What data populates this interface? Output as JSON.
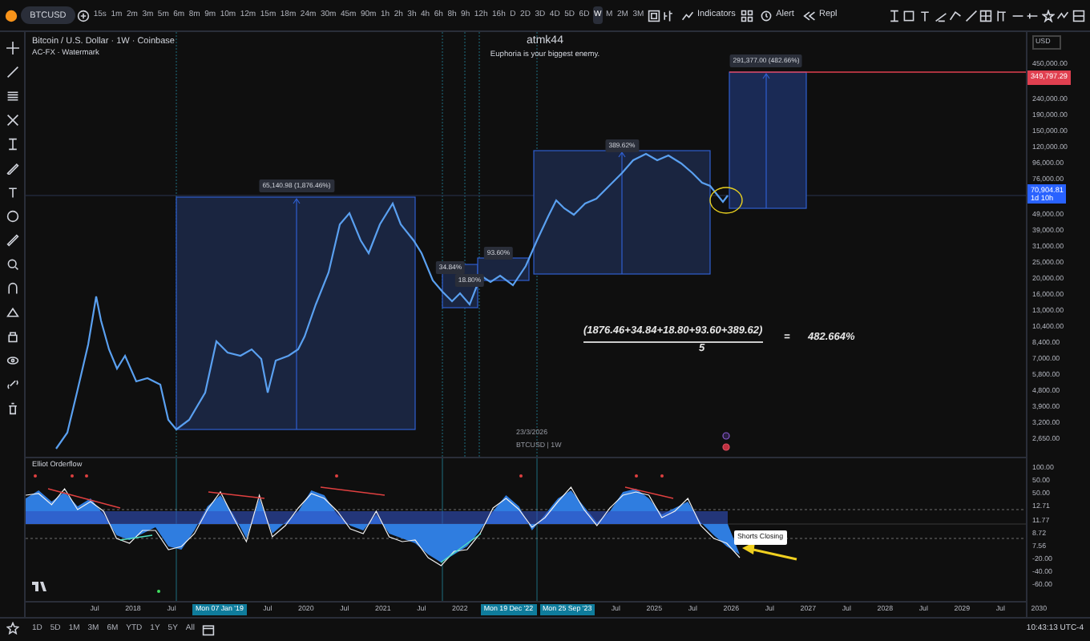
{
  "toolbar": {
    "symbol": "BTCUSD",
    "intervals": [
      {
        "label": "15s",
        "selected": false
      },
      {
        "label": "1m",
        "selected": false
      },
      {
        "label": "2m",
        "selected": false
      },
      {
        "label": "3m",
        "selected": false
      },
      {
        "label": "5m",
        "selected": false
      },
      {
        "label": "6m",
        "selected": false
      },
      {
        "label": "8m",
        "selected": false
      },
      {
        "label": "9m",
        "selected": false
      },
      {
        "label": "10m",
        "selected": false
      },
      {
        "label": "12m",
        "selected": false
      },
      {
        "label": "15m",
        "selected": false
      },
      {
        "label": "18m",
        "selected": false
      },
      {
        "label": "24m",
        "selected": false
      },
      {
        "label": "30m",
        "selected": false
      },
      {
        "label": "45m",
        "selected": false
      },
      {
        "label": "90m",
        "selected": false
      },
      {
        "label": "1h",
        "selected": false
      },
      {
        "label": "2h",
        "selected": false
      },
      {
        "label": "3h",
        "selected": false
      },
      {
        "label": "4h",
        "selected": false
      },
      {
        "label": "6h",
        "selected": false
      },
      {
        "label": "8h",
        "selected": false
      },
      {
        "label": "9h",
        "selected": false
      },
      {
        "label": "12h",
        "selected": false
      },
      {
        "label": "16h",
        "selected": false
      },
      {
        "label": "D",
        "selected": false
      },
      {
        "label": "2D",
        "selected": false
      },
      {
        "label": "3D",
        "selected": false
      },
      {
        "label": "4D",
        "selected": false
      },
      {
        "label": "5D",
        "selected": false
      },
      {
        "label": "6D",
        "selected": false
      },
      {
        "label": "W",
        "selected": true
      },
      {
        "label": "M",
        "selected": false
      },
      {
        "label": "2M",
        "selected": false
      },
      {
        "label": "3M",
        "selected": false
      }
    ],
    "indicators_button": "Indicators",
    "alert_button": "Alert",
    "replay_button": "Repl"
  },
  "legend": {
    "title": "Bitcoin / U.S. Dollar · 1W · Coinbase",
    "indicator": "AC-FX · Watermark"
  },
  "note": {
    "title": "atmk44",
    "subtitle": "Euphoria is your biggest enemy."
  },
  "measurements": [
    {
      "label": "65,140.98 (1,876.46%)"
    },
    {
      "label": "34.84%"
    },
    {
      "label": "18.80%"
    },
    {
      "label": "93.60%"
    },
    {
      "label": "389.62%"
    },
    {
      "label": "291,377.00 (482.66%)"
    }
  ],
  "formula": {
    "numerator": "(1876.46+34.84+18.80+93.60+389.62)",
    "denominator": "5",
    "equals": "=",
    "result": "482.664%"
  },
  "cursor_info": [
    "23/3/2026",
    "BTCUSD | 1W"
  ],
  "price_axis": {
    "currency": "USD",
    "ticks": [
      "450,000.00",
      "240,000.00",
      "190,000.00",
      "150,000.00",
      "120,000.00",
      "96,000.00",
      "76,000.00",
      "49,000.00",
      "39,000.00",
      "31,000.00",
      "25,000.00",
      "20,000.00",
      "16,000.00",
      "13,000.00",
      "10,400.00",
      "8,400.00",
      "7,000.00",
      "5,800.00",
      "4,800.00",
      "3,900.00",
      "3,200.00",
      "2,650.00"
    ],
    "alert_tag": "349,797.29",
    "last_price": "70,904.81",
    "countdown": "1d 10h"
  },
  "oscillator": {
    "title": "Elliot Orderflow",
    "tag": "Shorts Closing",
    "ticks": [
      "100.00",
      "50.00",
      "50.00",
      "12.71",
      "11.77",
      "8.72",
      "7.56",
      "-20.00",
      "-40.00",
      "-60.00"
    ]
  },
  "time_axis": [
    {
      "label": "Jul",
      "kind": "tick"
    },
    {
      "label": "2018",
      "kind": "tick"
    },
    {
      "label": "Jul",
      "kind": "tick"
    },
    {
      "label": "Mon 07 Jan '19",
      "kind": "marker"
    },
    {
      "label": "Jul",
      "kind": "tick"
    },
    {
      "label": "2020",
      "kind": "tick"
    },
    {
      "label": "Jul",
      "kind": "tick"
    },
    {
      "label": "2021",
      "kind": "tick"
    },
    {
      "label": "Jul",
      "kind": "tick"
    },
    {
      "label": "2022",
      "kind": "tick"
    },
    {
      "label": "Mon 19 Dec '22",
      "kind": "marker"
    },
    {
      "label": "Mon 25 Sep '23",
      "kind": "marker"
    },
    {
      "label": "Jul",
      "kind": "tick"
    },
    {
      "label": "2025",
      "kind": "tick"
    },
    {
      "label": "Jul",
      "kind": "tick"
    },
    {
      "label": "2026",
      "kind": "tick"
    },
    {
      "label": "Jul",
      "kind": "tick"
    },
    {
      "label": "2027",
      "kind": "tick"
    },
    {
      "label": "Jul",
      "kind": "tick"
    },
    {
      "label": "2028",
      "kind": "tick"
    },
    {
      "label": "Jul",
      "kind": "tick"
    },
    {
      "label": "2029",
      "kind": "tick"
    },
    {
      "label": "Jul",
      "kind": "tick"
    },
    {
      "label": "2030",
      "kind": "tick"
    }
  ],
  "bottom_bar": {
    "ranges": [
      "1D",
      "5D",
      "1M",
      "3M",
      "6M",
      "YTD",
      "1Y",
      "5Y",
      "All"
    ],
    "clock": "10:43:13 UTC-4"
  }
}
